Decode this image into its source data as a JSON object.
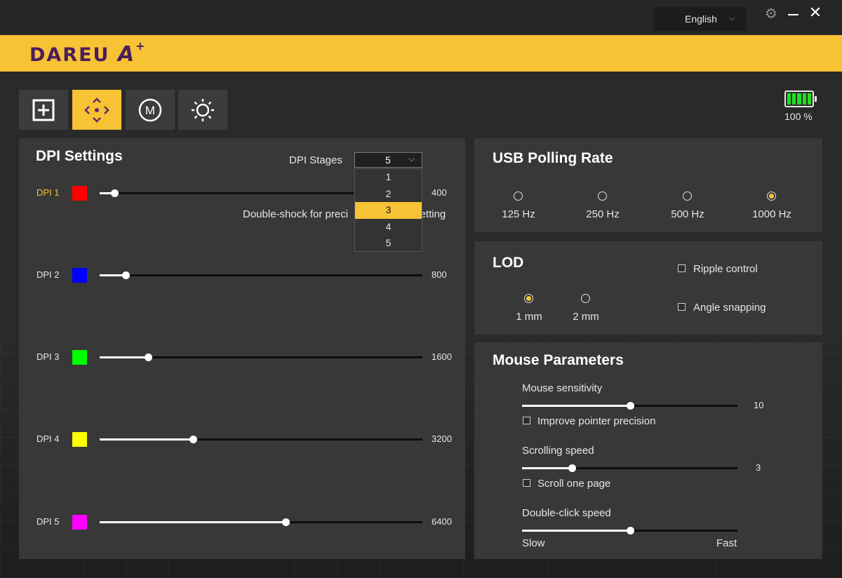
{
  "topbar": {
    "language": "English",
    "settings_icon": "gear-icon",
    "minimize_icon": "minimize-icon",
    "close_icon": "close-icon",
    "close_glyph": "✕",
    "gear_glyph": "⚙",
    "chevron_glyph": "⌵"
  },
  "brand": {
    "logo_text": "DAREU",
    "logo_mark": "A",
    "logo_plus": "+",
    "color": "#f7c234"
  },
  "modes": [
    {
      "name": "button-assignment",
      "icon": "plus-square-icon",
      "active": false
    },
    {
      "name": "dpi-performance",
      "icon": "move-arrows-icon",
      "active": true
    },
    {
      "name": "macro",
      "icon": "macro-m-icon",
      "glyph": "M",
      "active": false
    },
    {
      "name": "lighting",
      "icon": "sun-icon",
      "active": false
    }
  ],
  "battery": {
    "level": 1.0,
    "text": "100 %"
  },
  "dpi_settings": {
    "title": "DPI Settings",
    "stages_label": "DPI Stages",
    "stages_value": "5",
    "stages_options": [
      "1",
      "2",
      "3",
      "4",
      "5"
    ],
    "stages_highlighted": "3",
    "hint": "Double-shock for preci",
    "hint_tail": "setting",
    "rows": [
      {
        "label": "DPI 1",
        "color": "#ff0000",
        "value": "400",
        "fraction": 0.045,
        "active": true
      },
      {
        "label": "DPI 2",
        "color": "#0000ff",
        "value": "800",
        "fraction": 0.08,
        "active": false
      },
      {
        "label": "DPI 3",
        "color": "#00ff00",
        "value": "1600",
        "fraction": 0.15,
        "active": false
      },
      {
        "label": "DPI 4",
        "color": "#ffff00",
        "value": "3200",
        "fraction": 0.29,
        "active": false
      },
      {
        "label": "DPI 5",
        "color": "#ff00ff",
        "value": "6400",
        "fraction": 0.577,
        "active": false
      }
    ]
  },
  "polling": {
    "title": "USB Polling Rate",
    "options": [
      {
        "label": "125 Hz",
        "selected": false
      },
      {
        "label": "250 Hz",
        "selected": false
      },
      {
        "label": "500 Hz",
        "selected": false
      },
      {
        "label": "1000 Hz",
        "selected": true
      }
    ]
  },
  "lod": {
    "title": "LOD",
    "options": [
      {
        "label": "1 mm",
        "selected": true
      },
      {
        "label": "2 mm",
        "selected": false
      }
    ],
    "ripple_label": "Ripple control",
    "ripple_checked": false,
    "angle_label": "Angle snapping",
    "angle_checked": false
  },
  "mouse_params": {
    "title": "Mouse Parameters",
    "sensitivity_label": "Mouse sensitivity",
    "sensitivity_value": "10",
    "sensitivity_fraction": 0.5,
    "precision_label": "Improve pointer precision",
    "precision_checked": false,
    "scroll_label": "Scrolling speed",
    "scroll_value": "3",
    "scroll_fraction": 0.23,
    "scroll_page_label": "Scroll one page",
    "scroll_page_checked": false,
    "dblclick_label": "Double-click speed",
    "dblclick_fraction": 0.5,
    "slow_label": "Slow",
    "fast_label": "Fast"
  }
}
